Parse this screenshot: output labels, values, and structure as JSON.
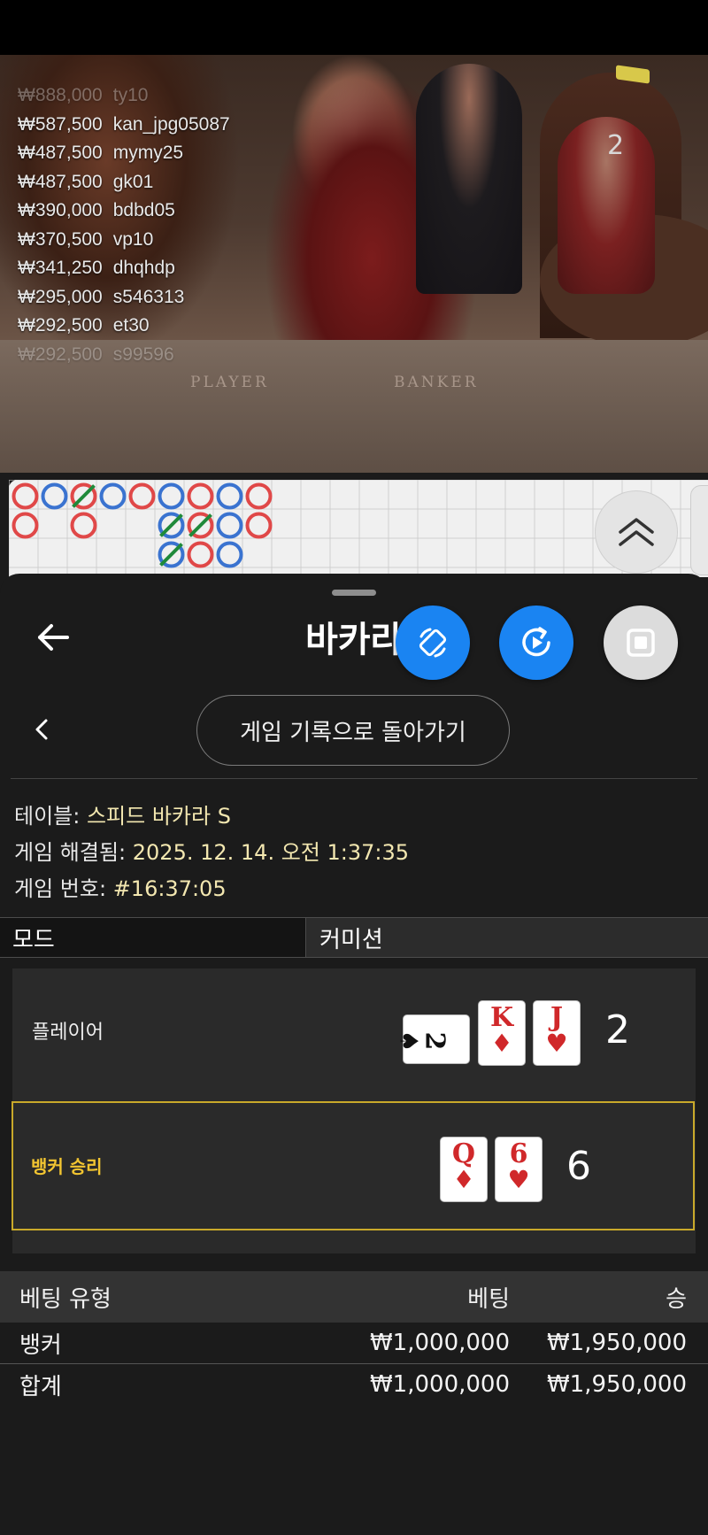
{
  "video": {
    "table_label_left": "PLAYER",
    "table_label_right": "BANKER",
    "count": "2",
    "winners": [
      {
        "amount": "₩888,000",
        "user": "ty10"
      },
      {
        "amount": "₩587,500",
        "user": "kan_jpg05087"
      },
      {
        "amount": "₩487,500",
        "user": "mymy25"
      },
      {
        "amount": "₩487,500",
        "user": "gk01"
      },
      {
        "amount": "₩390,000",
        "user": "bdbd05"
      },
      {
        "amount": "₩370,500",
        "user": "vp10"
      },
      {
        "amount": "₩341,250",
        "user": "dhqhdp"
      },
      {
        "amount": "₩295,000",
        "user": "s546313"
      },
      {
        "amount": "₩292,500",
        "user": "et30"
      },
      {
        "amount": "₩292,500",
        "user": "s99596"
      }
    ]
  },
  "roadmap": {
    "colors": {
      "banker": "#e04848",
      "player": "#3a73d0",
      "tie": "#1f8a3a"
    },
    "cells": [
      [
        "B",
        "B"
      ],
      [
        "P"
      ],
      [
        "B-tie",
        "B"
      ],
      [
        "P"
      ],
      [
        "B"
      ],
      [
        "P",
        "P-tie",
        "P-tie"
      ],
      [
        "B",
        "B-tie",
        "B"
      ],
      [
        "P",
        "P",
        "P"
      ],
      [
        "B",
        "B"
      ]
    ]
  },
  "header": {
    "title": "바카라",
    "back_icon": "arrow-left-icon",
    "fab_icons": [
      "rotate-device-icon",
      "replay-icon",
      "stop-icon"
    ]
  },
  "history_button": "게임 기록으로 돌아가기",
  "info": {
    "table_label": "테이블:",
    "table_value": "스피드 바카라 S",
    "resolved_label": "게임 해결됨:",
    "resolved_value": "2025. 12. 14. 오전 1:37:35",
    "round_label": "게임 번호:",
    "round_value": "#16:37:05"
  },
  "mode": {
    "label": "모드",
    "value": "커미션"
  },
  "player": {
    "label": "플레이어",
    "score": "2",
    "cards": [
      {
        "rank": "2",
        "suit": "♠",
        "color": "black",
        "sideways": true
      },
      {
        "rank": "K",
        "suit": "♦",
        "color": "red"
      },
      {
        "rank": "J",
        "suit": "♥",
        "color": "red"
      }
    ]
  },
  "banker": {
    "label": "뱅커 승리",
    "score": "6",
    "cards": [
      {
        "rank": "Q",
        "suit": "♦",
        "color": "red"
      },
      {
        "rank": "6",
        "suit": "♥",
        "color": "red"
      }
    ]
  },
  "bets": {
    "headers": {
      "type": "베팅 유형",
      "bet": "베팅",
      "win": "승"
    },
    "rows": [
      {
        "type": "뱅커",
        "bet": "₩1,000,000",
        "win": "₩1,950,000"
      },
      {
        "type": "합계",
        "bet": "₩1,000,000",
        "win": "₩1,950,000"
      }
    ]
  }
}
